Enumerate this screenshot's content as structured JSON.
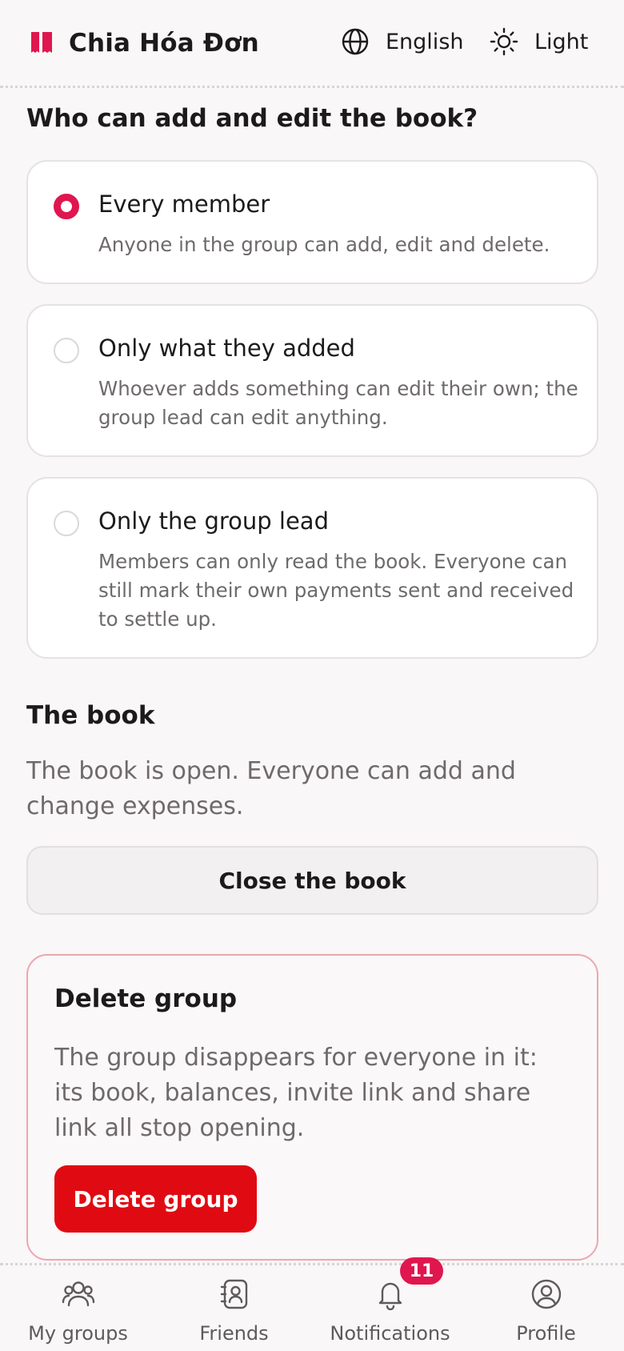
{
  "app": {
    "name": "Chia Hóa Đơn",
    "brand_color": "#e0164e"
  },
  "header": {
    "language_label": "English",
    "language_icon": "globe-icon",
    "theme_label": "Light",
    "theme_icon": "sun-icon"
  },
  "permissions": {
    "title": "Who can add and edit the book?",
    "options": [
      {
        "title": "Every member",
        "description": "Anyone in the group can add, edit and delete.",
        "selected": true
      },
      {
        "title": "Only what they added",
        "description": "Whoever adds something can edit their own; the group lead can edit anything.",
        "selected": false
      },
      {
        "title": "Only the group lead",
        "description": "Members can only read the book. Everyone can still mark their own payments sent and received to settle up.",
        "selected": false
      }
    ]
  },
  "book": {
    "title": "The book",
    "status": "The book is open. Everyone can add and change expenses.",
    "close_button": "Close the book"
  },
  "danger": {
    "title": "Delete group",
    "description": "The group disappears for everyone in it: its book, balances, invite link and share link all stop opening.",
    "button": "Delete group",
    "button_color": "#e00b12"
  },
  "nav": {
    "items": [
      {
        "label": "My groups",
        "icon": "users-icon"
      },
      {
        "label": "Friends",
        "icon": "contacts-icon"
      },
      {
        "label": "Notifications",
        "icon": "bell-icon",
        "badge": "11"
      },
      {
        "label": "Profile",
        "icon": "user-circle-icon"
      }
    ]
  }
}
